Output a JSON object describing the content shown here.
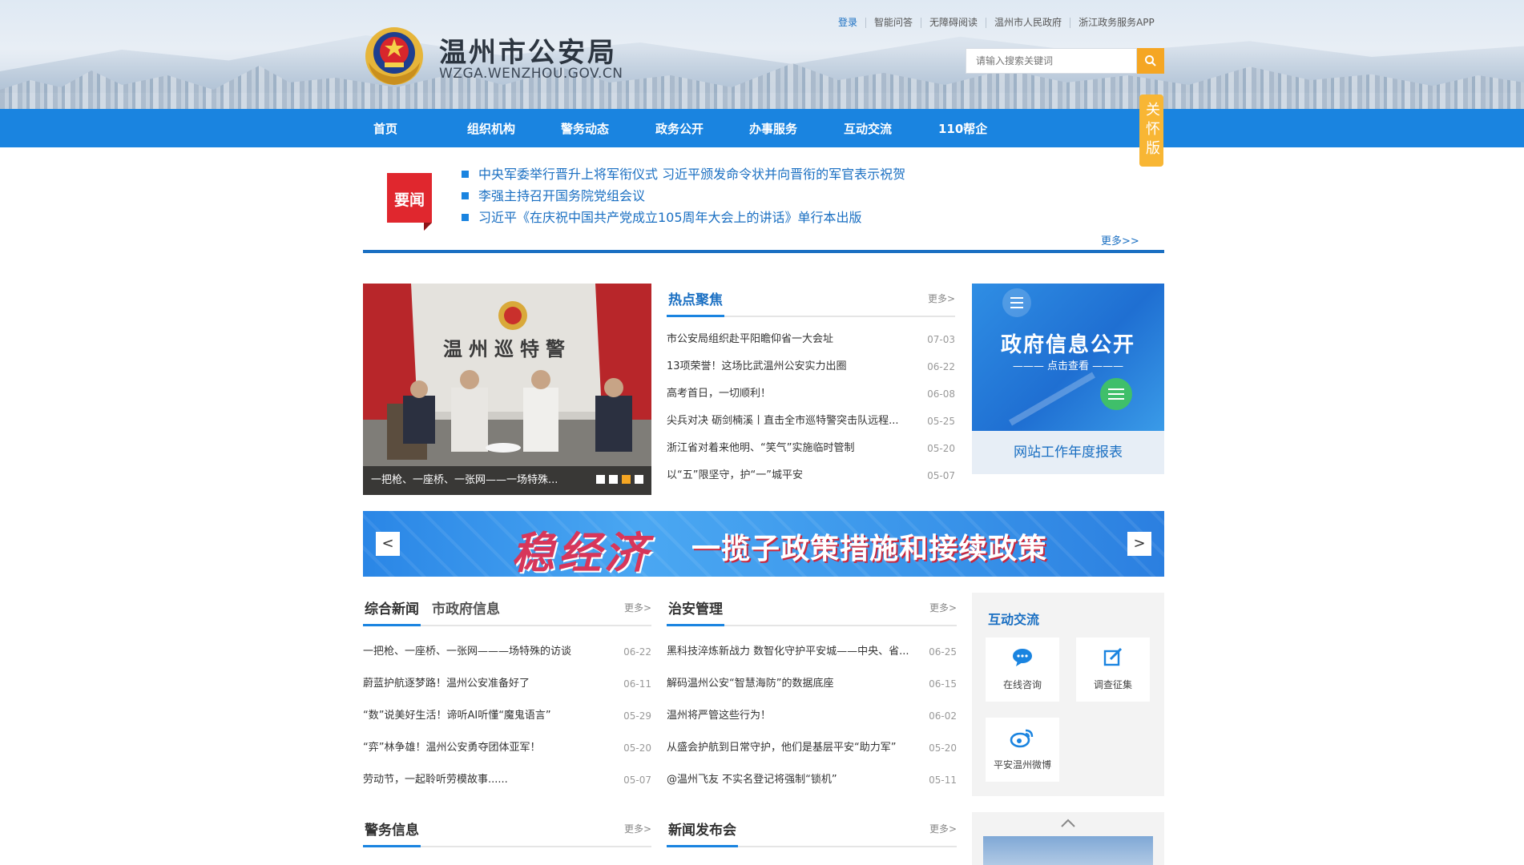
{
  "header": {
    "site_title": "温州市公安局",
    "site_domain": "WZGA.WENZHOU.GOV.CN",
    "top_links": [
      "登录",
      "智能问答",
      "无障碍阅读",
      "温州市人民政府",
      "浙江政务服务APP"
    ],
    "search_placeholder": "请输入搜索关键词"
  },
  "nav": {
    "items": [
      "首页",
      "组织机构",
      "警务动态",
      "政务公开",
      "办事服务",
      "互动交流",
      "110帮企"
    ],
    "care_mode": "关怀版"
  },
  "headlines": {
    "badge": "要闻",
    "items": [
      "中央军委举行晋升上将军衔仪式 习近平颁发命令状并向晋衔的军官表示祝贺",
      "李强主持召开国务院党组会议",
      "习近平《在庆祝中国共产党成立105周年大会上的讲话》单行本出版"
    ],
    "more": "更多>>"
  },
  "photo": {
    "sign_text": "温州巡特警",
    "caption": "一把枪、一座桥、一张网——一场特殊...",
    "active_slide": 3,
    "slide_count": 4
  },
  "hot_focus": {
    "title": "热点聚焦",
    "more": "更多>",
    "items": [
      {
        "text": "市公安局组织赴平阳瞻仰省一大会址",
        "date": "07-03"
      },
      {
        "text": "13项荣誉！这场比武温州公安实力出圈",
        "date": "06-22"
      },
      {
        "text": "高考首日，一切顺利！",
        "date": "06-08"
      },
      {
        "text": "尖兵对决 砺剑楠溪丨直击全市巡特警突击队远程...",
        "date": "05-25"
      },
      {
        "text": "浙江省对着来他明、“笑气”实施临时管制",
        "date": "05-20"
      },
      {
        "text": "以“五”限坚守，护“一”城平安",
        "date": "05-07"
      }
    ]
  },
  "gov_info": {
    "title": "政府信息公开",
    "subtitle": "——— 点击查看 ———",
    "report": "网站工作年度报表"
  },
  "banner": {
    "title": "稳经济",
    "subtitle": "一揽子政策措施和接续政策",
    "prev": "<",
    "next": ">"
  },
  "general_news": {
    "tab1": "综合新闻",
    "tab2": "市政府信息",
    "more": "更多>",
    "items": [
      {
        "text": "一把枪、一座桥、一张网———场特殊的访谈",
        "date": "06-22"
      },
      {
        "text": "蔚蓝护航逐梦路！温州公安准备好了",
        "date": "06-11"
      },
      {
        "text": "“数”说美好生活！谛听AI听懂“魔鬼语言”",
        "date": "05-29"
      },
      {
        "text": "“弈”林争雄！温州公安勇夺团体亚军！",
        "date": "05-20"
      },
      {
        "text": "劳动节，一起聆听劳模故事......",
        "date": "05-07"
      }
    ]
  },
  "security": {
    "title": "治安管理",
    "more": "更多>",
    "items": [
      {
        "text": "黑科技淬炼新战力 数智化守护平安城——中央、省...",
        "date": "06-25"
      },
      {
        "text": "解码温州公安“智慧海防”的数据底座",
        "date": "06-15"
      },
      {
        "text": "温州将严管这些行为！",
        "date": "06-02"
      },
      {
        "text": "从盛会护航到日常守护，他们是基层平安“助力军”",
        "date": "05-20"
      },
      {
        "text": "@温州飞友 不实名登记将强制“锁机”",
        "date": "05-11"
      }
    ]
  },
  "interaction": {
    "title": "互动交流",
    "tiles": [
      "在线咨询",
      "调查征集",
      "平安温州微博"
    ]
  },
  "police_info": {
    "title": "警务信息",
    "more": "更多>"
  },
  "press": {
    "title": "新闻发布会",
    "more": "更多>"
  },
  "colors": {
    "primary": "#1a84e0",
    "accent": "#f5a623",
    "badge_red": "#e0272e",
    "link": "#1a6fc2"
  }
}
